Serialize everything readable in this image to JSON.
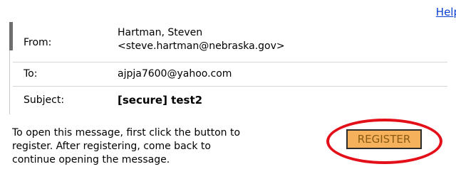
{
  "header": {
    "help_link": "Help"
  },
  "message": {
    "from_label": "From:",
    "from_name": "Hartman, Steven",
    "from_email": "<steve.hartman@nebraska.gov>",
    "to_label": "To:",
    "to_value": "ajpja7600@yahoo.com",
    "subject_label": "Subject:",
    "subject_value": "[secure] test2"
  },
  "instructions": {
    "line1": "To open this message, first click the button to",
    "line2": "register. After registering, come back to",
    "line3": "continue opening the message."
  },
  "register": {
    "button_label": "REGISTER"
  },
  "colors": {
    "link": "#0a3fd0",
    "register_bg": "#f5b15b",
    "highlight_ring": "#e3101a"
  }
}
